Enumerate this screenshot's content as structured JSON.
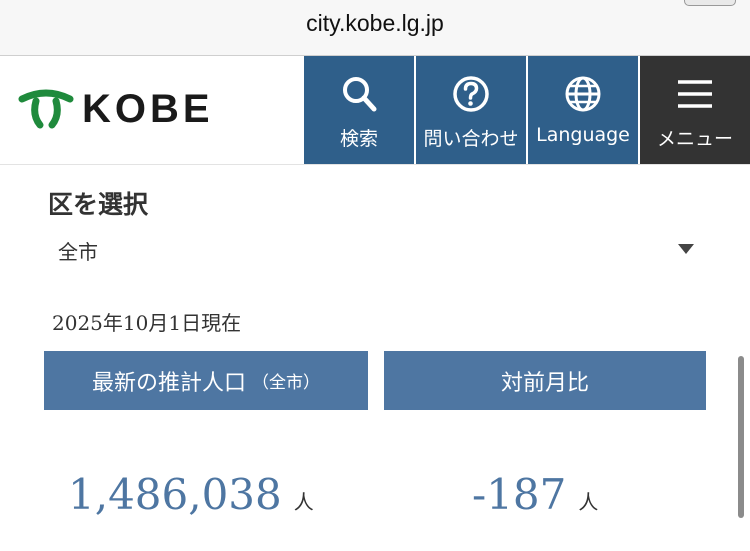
{
  "browser": {
    "url": "city.kobe.lg.jp"
  },
  "header": {
    "logo_text": "KOBE",
    "nav": {
      "search_label": "検索",
      "contact_label": "問い合わせ",
      "language_label": "Language",
      "menu_label": "メニュー"
    }
  },
  "colors": {
    "nav_blue": "#2f5f8a",
    "menu_dark": "#333333",
    "accent_blue": "#4e76a2",
    "logo_green": "#1f8a3c"
  },
  "ward_select": {
    "title": "区を選択",
    "selected": "全市"
  },
  "stats": {
    "as_of": "2025年10月1日現在",
    "latest_label": "最新の推計人口",
    "latest_sub": "（全市）",
    "mom_label": "対前月比",
    "population": "1,486,038",
    "population_unit": "人",
    "change": "-187",
    "change_unit": "人"
  }
}
